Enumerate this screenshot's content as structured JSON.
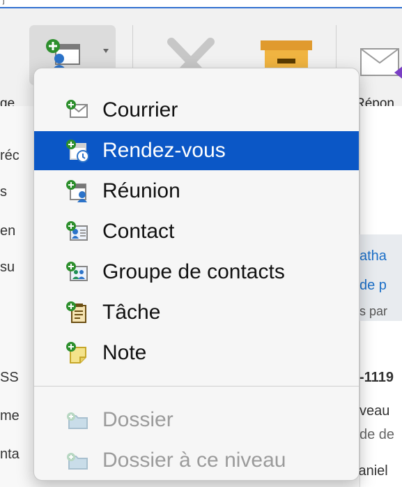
{
  "window": {
    "top_fragment": "j",
    "toolbar": {
      "left_label_fragment": "ge",
      "reply_label_fragment": "Répon",
      "new_items_icon": "new-item-icon",
      "delete_icon": "delete-icon",
      "archive_icon": "archive-icon",
      "reply_icon": "reply-icon"
    }
  },
  "left_fragments": [
    "réc",
    "s",
    "en",
    "su",
    "SS",
    "me",
    "nta"
  ],
  "right_fragments": [
    "atha",
    "de p",
    "s par",
    "-1119",
    "veau",
    "de de"
  ],
  "bottom_fragment": "Daniel",
  "menu": {
    "items": [
      {
        "label": "Courrier",
        "icon": "mail-icon",
        "selected": false,
        "disabled": false
      },
      {
        "label": "Rendez-vous",
        "icon": "appointment-icon",
        "selected": true,
        "disabled": false
      },
      {
        "label": "Réunion",
        "icon": "meeting-icon",
        "selected": false,
        "disabled": false
      },
      {
        "label": "Contact",
        "icon": "contact-icon",
        "selected": false,
        "disabled": false
      },
      {
        "label": "Groupe de contacts",
        "icon": "contact-group-icon",
        "selected": false,
        "disabled": false
      },
      {
        "label": "Tâche",
        "icon": "task-icon",
        "selected": false,
        "disabled": false
      },
      {
        "label": "Note",
        "icon": "note-icon",
        "selected": false,
        "disabled": false
      },
      {
        "label": "Dossier",
        "icon": "folder-icon",
        "selected": false,
        "disabled": true
      },
      {
        "label": "Dossier à ce niveau",
        "icon": "folder-level-icon",
        "selected": false,
        "disabled": true
      }
    ]
  }
}
